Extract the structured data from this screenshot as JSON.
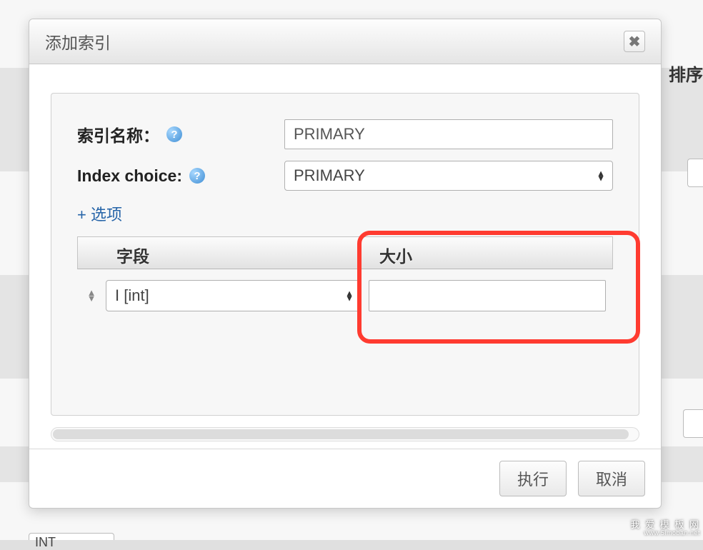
{
  "background": {
    "side_text": "排序",
    "int_label": "INT"
  },
  "dialog": {
    "title": "添加索引",
    "labels": {
      "index_name": "索引名称：",
      "index_choice": "Index choice:"
    },
    "index_name_value": "PRIMARY",
    "index_choice_value": "PRIMARY",
    "options_link": "+ 选项",
    "columns": {
      "field": "字段",
      "size": "大小"
    },
    "rows": [
      {
        "field": "I [int]",
        "size": ""
      }
    ],
    "buttons": {
      "execute": "执行",
      "cancel": "取消"
    }
  },
  "watermark": {
    "line1": "我 爱 模 板 网",
    "line2": "www.5imoban.net"
  }
}
